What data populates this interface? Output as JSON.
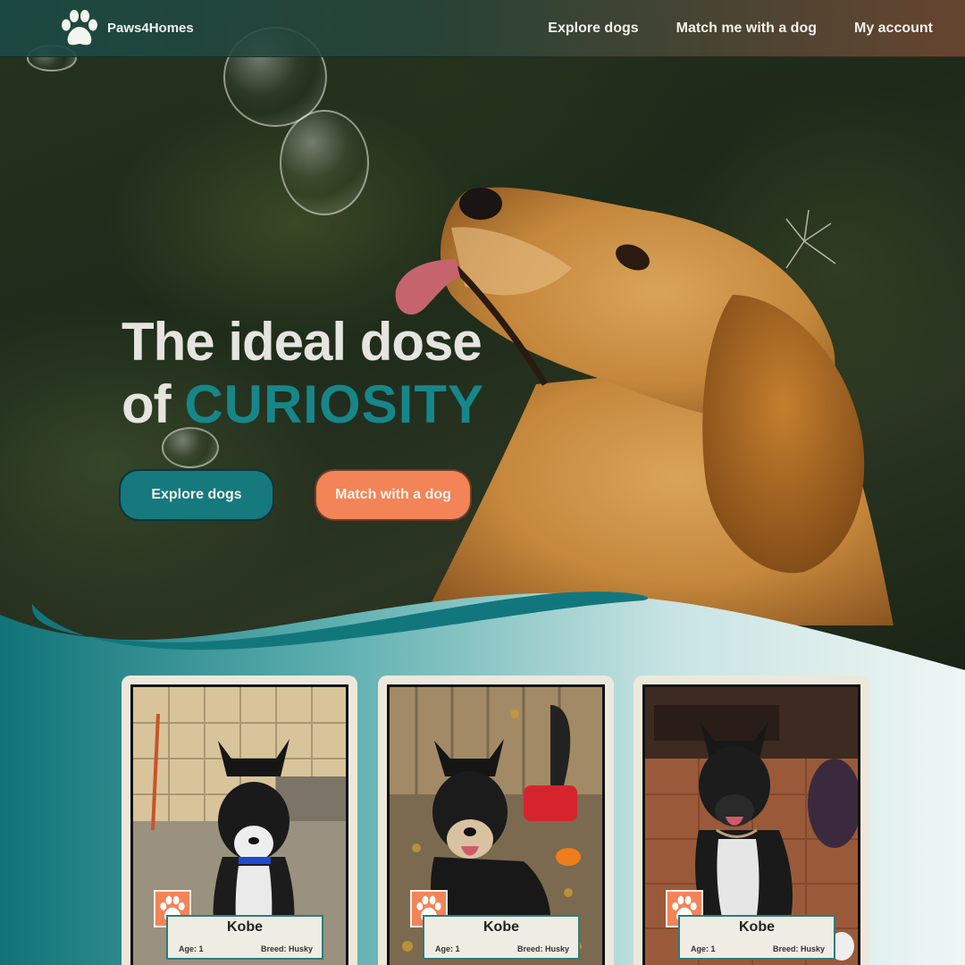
{
  "nav": {
    "brand": "Paws4Homes",
    "links": [
      "Explore dogs",
      "Match me with a dog",
      "My account"
    ]
  },
  "hero": {
    "headline_line1": "The ideal dose",
    "headline_of": "of",
    "headline_accent": "CURIOSITY",
    "cta_primary": "Explore dogs",
    "cta_secondary": "Match with a dog"
  },
  "colors": {
    "teal": "#15797d",
    "orange": "#f28457",
    "cream": "#ece8dc"
  },
  "dogs": [
    {
      "name": "Kobe",
      "age": "Age: 1",
      "breed": "Breed: Husky"
    },
    {
      "name": "Kobe",
      "age": "Age: 1",
      "breed": "Breed: Husky"
    },
    {
      "name": "Kobe",
      "age": "Age: 1",
      "breed": "Breed: Husky"
    }
  ],
  "icons": {
    "brand": "paw-icon",
    "card_badge": "paw-icon"
  }
}
